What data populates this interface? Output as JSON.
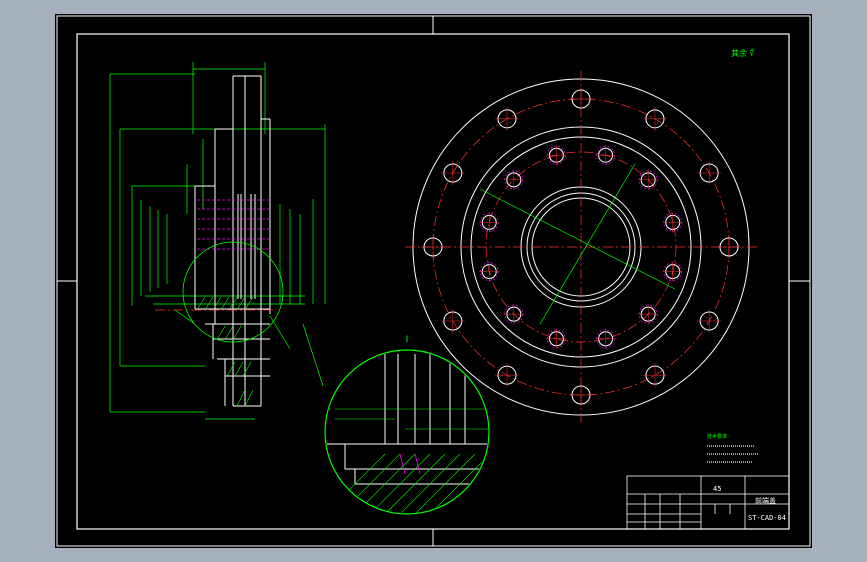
{
  "drawing": {
    "background_color": "#000000",
    "frame_color": "#ffffff",
    "outline_color": "#ffffff",
    "dimension_color": "#00ff00",
    "centerline_color": "#ff3030",
    "hidden_color": "#ff00ff",
    "title_block": {
      "part_name": "前端盖",
      "material": "45",
      "drawing_number": "ST-CAD-04"
    },
    "roughness_note": "其余 ∜",
    "tech_notes_title": "技术要求",
    "detail_label": "I"
  }
}
